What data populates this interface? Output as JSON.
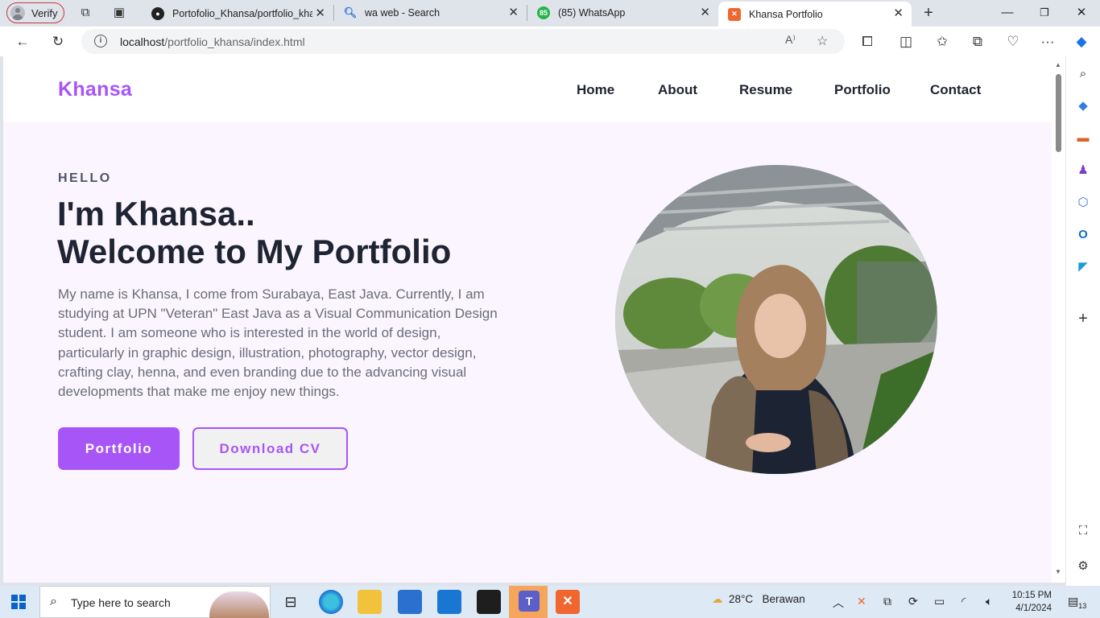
{
  "browser": {
    "profile_label": "Verify",
    "tabs": [
      {
        "title": "Portofolio_Khansa/portfolio_khansa",
        "favicon": "github-icon"
      },
      {
        "title": "wa web - Search",
        "favicon": "search-icon"
      },
      {
        "title": "(85) WhatsApp",
        "favicon": "whatsapp-icon",
        "badge": "85"
      },
      {
        "title": "Khansa Portfolio",
        "favicon": "xampp-icon",
        "active": true
      }
    ],
    "url_host": "localhost",
    "url_path": "/portfolio_khansa/index.html"
  },
  "site": {
    "logo": "Khansa",
    "nav": [
      "Home",
      "About",
      "Resume",
      "Portfolio",
      "Contact"
    ],
    "hero": {
      "eyebrow": "HELLO",
      "line1_prefix": "I'm ",
      "line1_bold": "Khansa..",
      "line2_bold": "Welcome",
      "line2_rest": " to My Portfolio",
      "description": "My name is Khansa, I come from Surabaya, East Java. Currently, I am studying at UPN \"Veteran\" East Java as a Visual Communication Design student. I am someone who is interested in the world of design, particularly in graphic design, illustration, photography, vector design, crafting clay, henna, and even branding due to the advancing visual developments that make me enjoy new things.",
      "primary_button": "Portfolio",
      "secondary_button": "Download CV"
    },
    "accent_color": "#a855f7",
    "hero_bg": "#fbf5ff"
  },
  "taskbar": {
    "search_placeholder": "Type here to search",
    "weather_temp": "28°C",
    "weather_desc": "Berawan",
    "time": "10:15 PM",
    "date": "4/1/2024",
    "notifications": "13"
  }
}
